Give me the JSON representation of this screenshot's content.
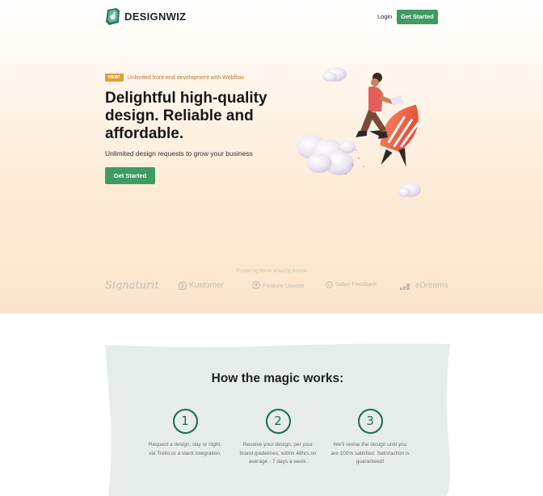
{
  "brand": {
    "name": "DESIGNWIZ",
    "logo_icon": "designwiz-logo-icon",
    "accent_color": "#3f9b62"
  },
  "nav": {
    "login_label": "Login",
    "cta_label": "Get Started"
  },
  "hero": {
    "badge": "NEW!",
    "badge_text": "Unlimited front-end development with Webflow",
    "headline": "Delightful high-quality design. Reliable and affordable.",
    "subheadline": "Unlimited design requests to grow your business",
    "cta_label": "Get Started",
    "illustration_icon": "woman-riding-rocket-illustration"
  },
  "trusted": {
    "label": "Trusted by these amazing brands",
    "brands": [
      {
        "name": "Signaturit",
        "icon": ""
      },
      {
        "name": "Kustomer",
        "icon": "kustomer-logo-icon"
      },
      {
        "name": "Feature Upvote",
        "icon": "upvote-arrow-icon"
      },
      {
        "name": "Saber Feedback",
        "icon": "saber-feedback-icon"
      },
      {
        "name": "eDreams",
        "icon": "edreams-logo-icon"
      }
    ]
  },
  "how_it_works": {
    "title": "How the magic works:",
    "steps": [
      {
        "number": "1",
        "text": "Request a design, day or night, via Trello or a slack integration."
      },
      {
        "number": "2",
        "text": "Receive your design, per your brand guidelines, within 48hrs on average - 7 days a week."
      },
      {
        "number": "3",
        "text": "We'll revise the design until you are 100% satisfied. Satisfaction is guaranteed!"
      }
    ]
  }
}
